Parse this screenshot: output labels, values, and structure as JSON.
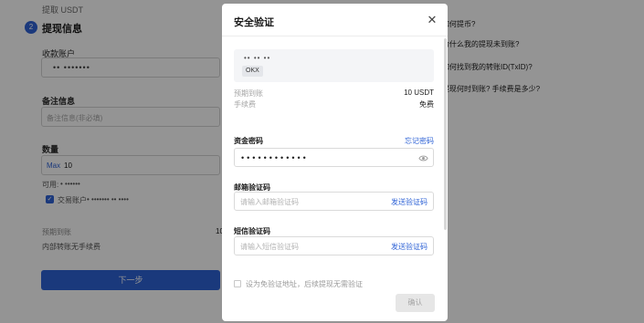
{
  "background": {
    "step_top": "提取 USDT",
    "step_number": "2",
    "step_title": "提现信息",
    "receiver_label": "收款账户",
    "receiver_value": "•• •••••••",
    "remark_label": "备注信息",
    "remark_placeholder": "备注信息(非必填)",
    "amount_label": "数量",
    "amount_max": "Max",
    "amount_value": "10",
    "available_label": "可用:",
    "available_value": "• ••••••",
    "trading_account_label": "交易账户",
    "trading_account_value": "• ••••••• •• ••••",
    "expected_label": "预期到账",
    "expected_value": "10",
    "internal_fee_note": "内部转账无手续费",
    "submit_label": "下一步",
    "faq": [
      "如何提币?",
      "为什么我的提现未到账?",
      "如何找到我的转账ID(TxID)?",
      "提现何时到账? 手续费是多少?"
    ]
  },
  "modal": {
    "title": "安全验证",
    "close_icon": "close-icon",
    "address_masked": "•• •• ••",
    "address_tag": "OKX",
    "expected_label": "预期到账",
    "expected_value": "10 USDT",
    "fee_label": "手续费",
    "fee_value": "免费",
    "fund_password_label": "资金密码",
    "forgot_password_label": "忘记密码",
    "password_value": "••••••••••••",
    "eye_icon": "eye-icon",
    "email_code_label": "邮箱验证码",
    "email_code_placeholder": "请输入邮箱验证码",
    "email_send_label": "发送验证码",
    "sms_code_label": "短信验证码",
    "sms_code_placeholder": "请输入短信验证码",
    "sms_send_label": "发送验证码",
    "free_address_label": "设为免验证地址，后续提现无需验证",
    "confirm_label": "确认"
  },
  "colors": {
    "accent": "#2f63d6",
    "overlay": "#000000",
    "disabled_button": "#e6e6e6"
  }
}
